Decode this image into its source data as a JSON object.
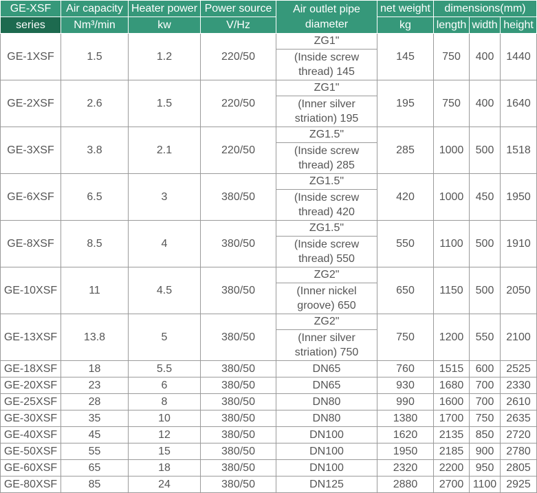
{
  "colors": {
    "header_bg": "#36987a",
    "series_cell_bg": "#1d6a4f",
    "header_text": "#ffffff",
    "body_text": "#555555",
    "grid_line": "#9a9a9a"
  },
  "table": {
    "header": {
      "model_group": "GE-XSF",
      "air_capacity": "Air capacity",
      "heater_power": "Heater power",
      "power_source": "Power source",
      "pipe_diameter": "Air outlet pipe diameter",
      "net_weight": "net weight",
      "dimensions": "dimensions(mm)"
    },
    "subheader": {
      "series": "series",
      "air_capacity_unit": "Nm³/min",
      "heater_power_unit": "kw",
      "power_source_unit": "V/Hz",
      "net_weight_unit": "kg",
      "length": "length",
      "width": "width",
      "height": "height"
    },
    "rows": [
      {
        "model": "GE-1XSF",
        "air_capacity": "1.5",
        "heater_power": "1.2",
        "power_source": "220/50",
        "pipe": "ZG1\"",
        "pipe_note": "(Inside screw thread) 145",
        "net_weight": "145",
        "length": "750",
        "width": "400",
        "height": "1440"
      },
      {
        "model": "GE-2XSF",
        "air_capacity": "2.6",
        "heater_power": "1.5",
        "power_source": "220/50",
        "pipe": "ZG1\"",
        "pipe_note": "(Inner silver striation) 195",
        "net_weight": "195",
        "length": "750",
        "width": "400",
        "height": "1640"
      },
      {
        "model": "GE-3XSF",
        "air_capacity": "3.8",
        "heater_power": "2.1",
        "power_source": "220/50",
        "pipe": "ZG1.5\"",
        "pipe_note": "(Inside screw thread) 285",
        "net_weight": "285",
        "length": "1000",
        "width": "500",
        "height": "1518"
      },
      {
        "model": "GE-6XSF",
        "air_capacity": "6.5",
        "heater_power": "3",
        "power_source": "380/50",
        "pipe": "ZG1.5\"",
        "pipe_note": "(Inside screw thread) 420",
        "net_weight": "420",
        "length": "1000",
        "width": "450",
        "height": "1950"
      },
      {
        "model": "GE-8XSF",
        "air_capacity": "8.5",
        "heater_power": "4",
        "power_source": "380/50",
        "pipe": "ZG1.5\"",
        "pipe_note": "(Inside screw thread) 550",
        "net_weight": "550",
        "length": "1100",
        "width": "500",
        "height": "1910"
      },
      {
        "model": "GE-10XSF",
        "air_capacity": "11",
        "heater_power": "4.5",
        "power_source": "380/50",
        "pipe": "ZG2\"",
        "pipe_note": "(Inner nickel groove) 650",
        "net_weight": "650",
        "length": "1150",
        "width": "500",
        "height": "2050"
      },
      {
        "model": "GE-13XSF",
        "air_capacity": "13.8",
        "heater_power": "5",
        "power_source": "380/50",
        "pipe": "ZG2\"",
        "pipe_note": "(Inner silver striation) 750",
        "net_weight": "750",
        "length": "1200",
        "width": "550",
        "height": "2100"
      },
      {
        "model": "GE-18XSF",
        "air_capacity": "18",
        "heater_power": "5.5",
        "power_source": "380/50",
        "pipe": "DN65",
        "net_weight": "760",
        "length": "1515",
        "width": "600",
        "height": "2525"
      },
      {
        "model": "GE-20XSF",
        "air_capacity": "23",
        "heater_power": "6",
        "power_source": "380/50",
        "pipe": "DN65",
        "net_weight": "930",
        "length": "1680",
        "width": "700",
        "height": "2330"
      },
      {
        "model": "GE-25XSF",
        "air_capacity": "28",
        "heater_power": "8",
        "power_source": "380/50",
        "pipe": "DN80",
        "net_weight": "990",
        "length": "1600",
        "width": "700",
        "height": "2610"
      },
      {
        "model": "GE-30XSF",
        "air_capacity": "35",
        "heater_power": "10",
        "power_source": "380/50",
        "pipe": "DN80",
        "net_weight": "1380",
        "length": "1700",
        "width": "750",
        "height": "2635"
      },
      {
        "model": "GE-40XSF",
        "air_capacity": "45",
        "heater_power": "12",
        "power_source": "380/50",
        "pipe": "DN100",
        "net_weight": "1620",
        "length": "2135",
        "width": "850",
        "height": "2720"
      },
      {
        "model": "GE-50XSF",
        "air_capacity": "55",
        "heater_power": "15",
        "power_source": "380/50",
        "pipe": "DN100",
        "net_weight": "1950",
        "length": "2185",
        "width": "900",
        "height": "2780"
      },
      {
        "model": "GE-60XSF",
        "air_capacity": "65",
        "heater_power": "18",
        "power_source": "380/50",
        "pipe": "DN100",
        "net_weight": "2320",
        "length": "2200",
        "width": "950",
        "height": "2805"
      },
      {
        "model": "GE-80XSF",
        "air_capacity": "85",
        "heater_power": "24",
        "power_source": "380/50",
        "pipe": "DN125",
        "net_weight": "2880",
        "length": "2700",
        "width": "1100",
        "height": "2925"
      }
    ]
  }
}
